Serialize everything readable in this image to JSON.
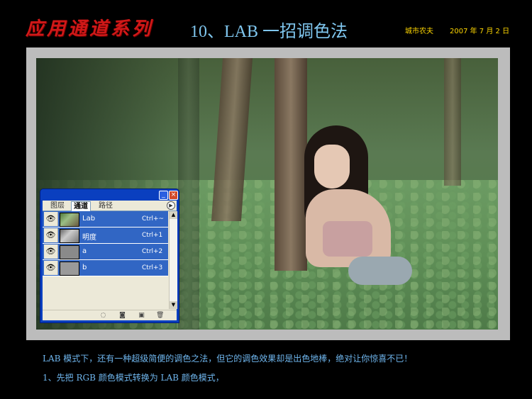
{
  "header": {
    "series_title": "应用通道系列",
    "lesson_title": "10、LAB 一招调色法",
    "author": "城市农夫",
    "date": "2007 年 7 月 2 日"
  },
  "palette": {
    "tabs": [
      "图层",
      "通道",
      "路径"
    ],
    "active_tab": "通道",
    "channels": [
      {
        "name": "Lab",
        "shortcut": "Ctrl+~"
      },
      {
        "name": "明度",
        "shortcut": "Ctrl+1"
      },
      {
        "name": "a",
        "shortcut": "Ctrl+2"
      },
      {
        "name": "b",
        "shortcut": "Ctrl+3"
      }
    ],
    "footer_icons": [
      "load-selection-icon",
      "save-selection-icon",
      "new-channel-icon",
      "delete-channel-icon"
    ]
  },
  "captions": {
    "line1": "LAB 模式下，还有一种超级简便的调色之法，但它的调色效果却是出色地棒，绝对让你惊喜不已！",
    "line2": "1、先把 RGB 颜色模式转换为 LAB 颜色模式，"
  },
  "colors": {
    "series_title": "#d01818",
    "lesson_title": "#7fc6ee",
    "meta": "#ffd700",
    "caption": "#6fb6ee",
    "palette_selection": "#3166c4"
  }
}
